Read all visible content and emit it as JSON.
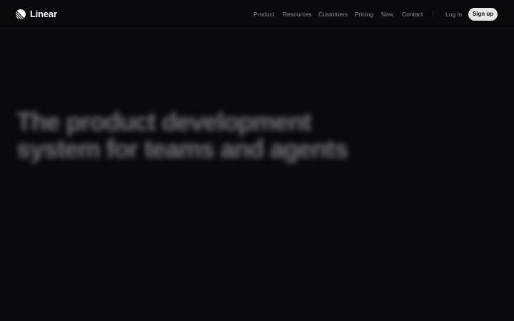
{
  "header": {
    "brand": "Linear",
    "nav": [
      {
        "label": "Product"
      },
      {
        "label": "Resources"
      },
      {
        "label": "Customers"
      },
      {
        "label": "Pricing"
      },
      {
        "label": "Now"
      },
      {
        "label": "Contact"
      }
    ],
    "login": "Log in",
    "signup": "Sign up"
  },
  "hero": {
    "line1": "The product development",
    "line2": "system for teams and agents"
  },
  "colors": {
    "background": "#08090a",
    "nav_text": "#8a8f98",
    "brand_text": "#f7f8f8",
    "button_bg": "#e6e6e6"
  },
  "icons": {
    "logo": "linear-logo-icon"
  }
}
